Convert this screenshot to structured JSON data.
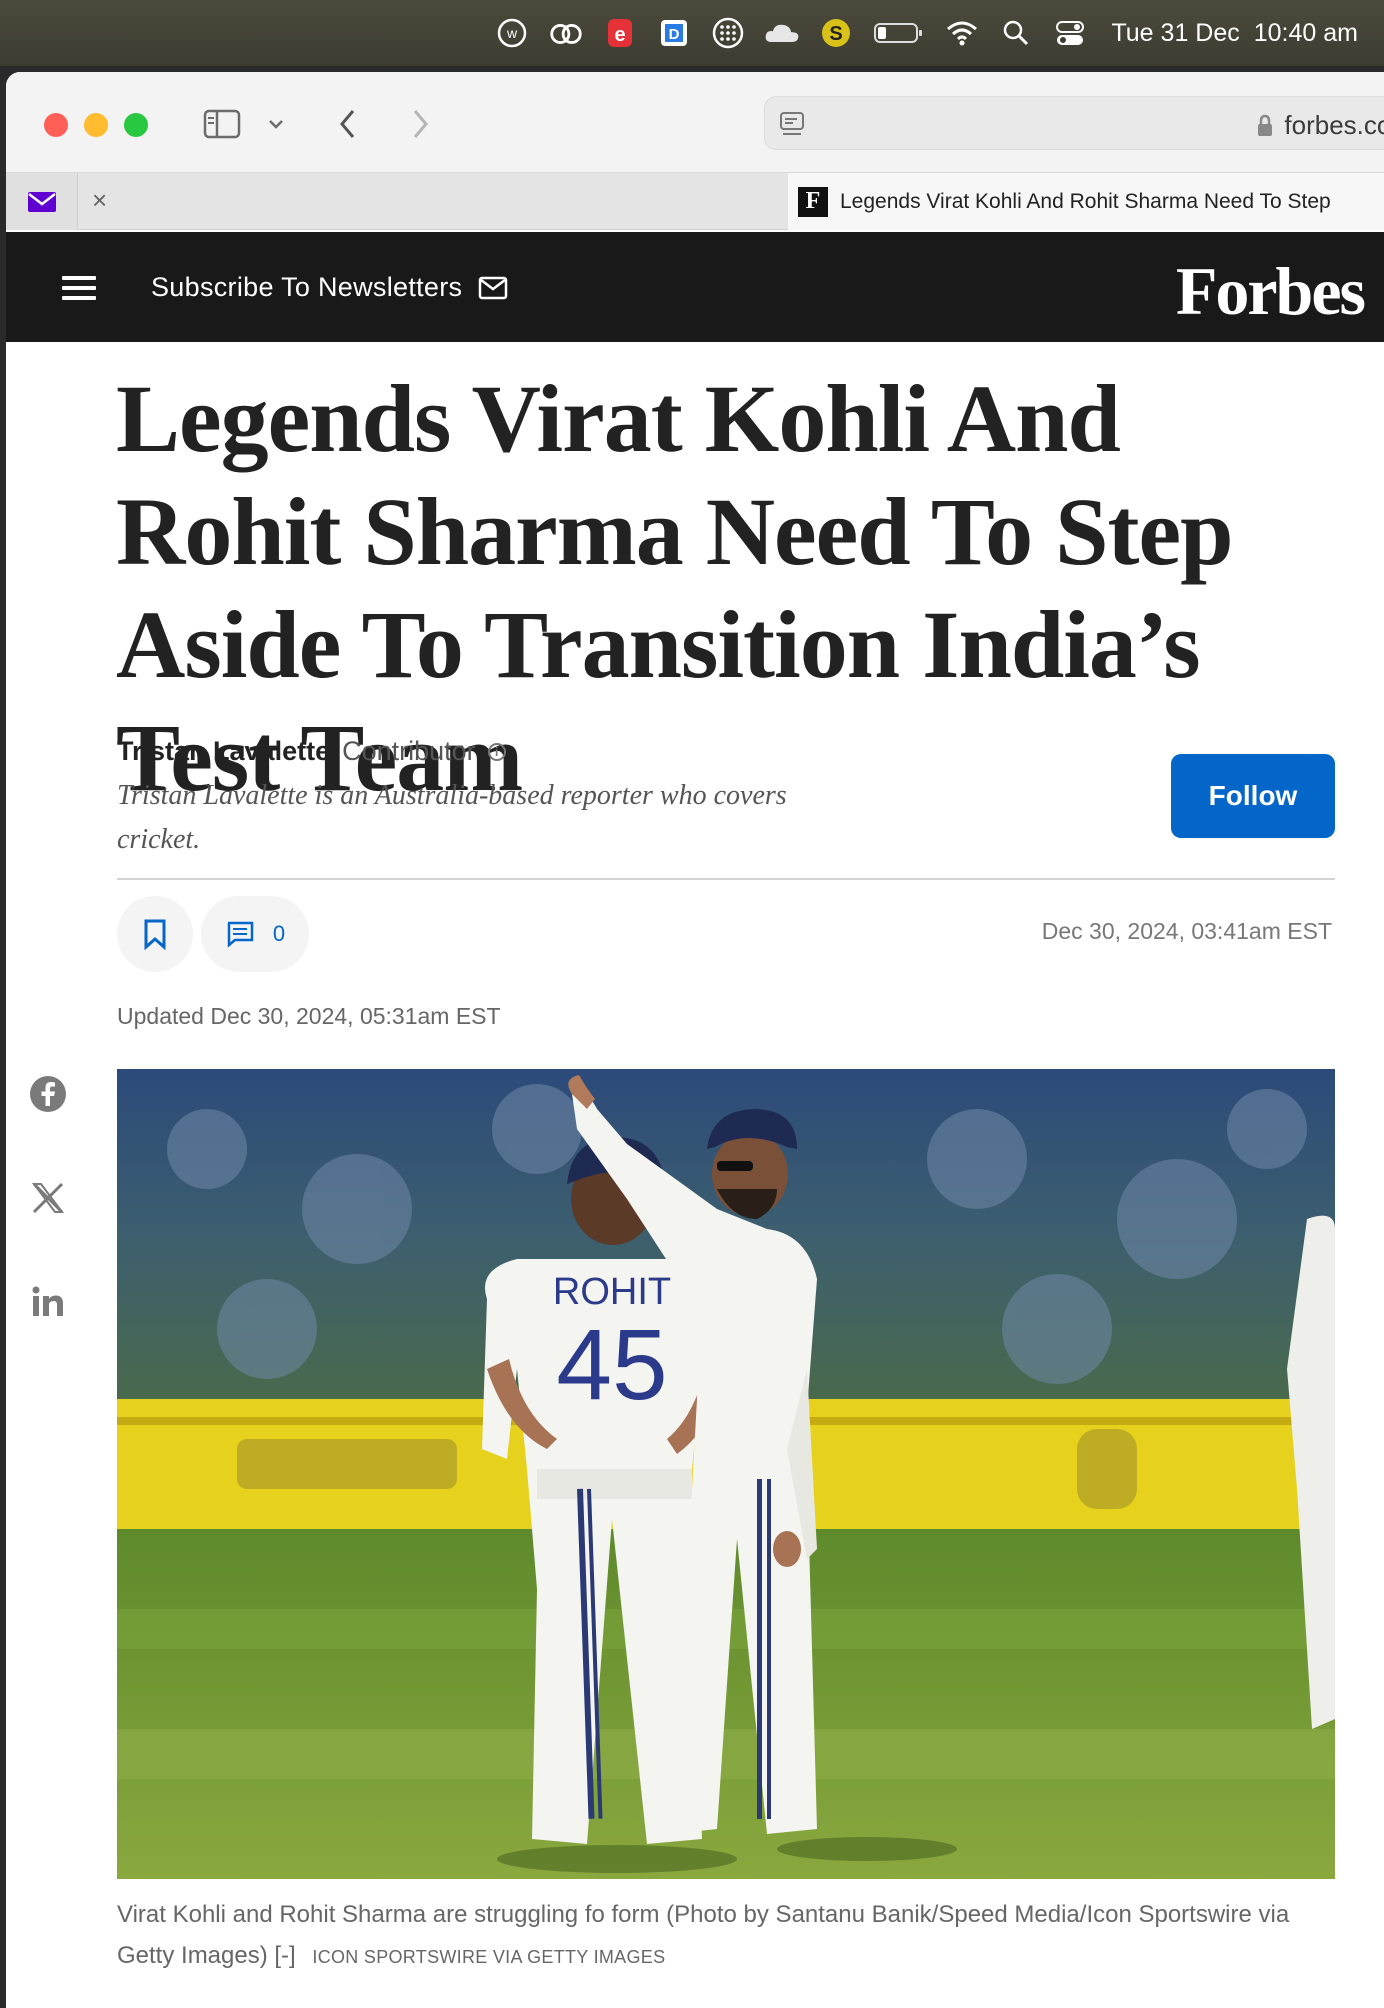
{
  "menubar": {
    "date": "Tue 31 Dec",
    "time": "10:40 am"
  },
  "browser": {
    "url_host": "forbes.com",
    "tab_title": "Legends Virat Kohli And Rohit Sharma Need To Step",
    "tab_favicon_letter": "F"
  },
  "site": {
    "subscribe_label": "Subscribe To Newsletters",
    "logo": "Forbes"
  },
  "article": {
    "headline": "Legends Virat Kohli And Rohit Sharma Need To Step Aside To Transition India’s Test Team",
    "author": "Tristan Lavalette",
    "author_role": "Contributor",
    "author_bio": "Tristan Lavalette is an Australia-based reporter who covers cricket.",
    "follow_label": "Follow",
    "comment_count": "0",
    "published": "Dec 30, 2024, 03:41am EST",
    "updated": "Updated Dec 30, 2024, 05:31am EST",
    "photo_jersey_name": "ROHIT",
    "photo_jersey_number": "45",
    "caption": "Virat Kohli and Rohit Sharma are struggling fo form (Photo by Santanu Banik/Speed Media/Icon Sportswire via Getty Images) [-]",
    "credit": "ICON SPORTSWIRE VIA GETTY IMAGES"
  },
  "colors": {
    "header_bg": "#191919",
    "follow_blue": "#0366c8",
    "icon_blue": "#0366c8"
  }
}
